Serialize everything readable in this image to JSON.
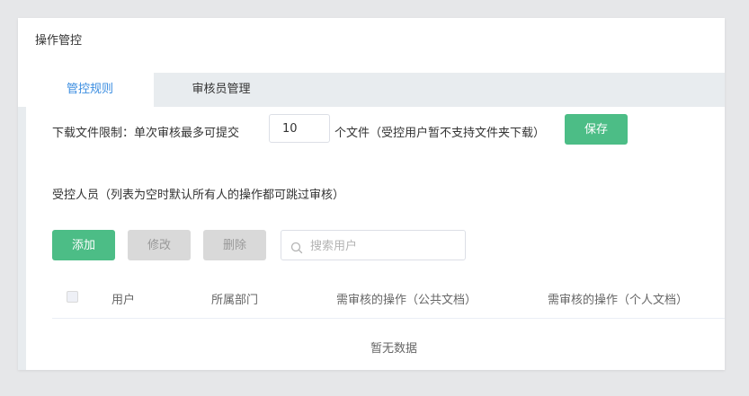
{
  "page": {
    "title": "操作管控"
  },
  "tabs": [
    {
      "label": "管控规则",
      "active": true
    },
    {
      "label": "审核员管理",
      "active": false
    }
  ],
  "download_limit": {
    "prefix": "下载文件限制：单次审核最多可提交",
    "value": "10",
    "suffix": "个文件（受控用户暂不支持文件夹下载）",
    "save_label": "保存"
  },
  "controlled_users": {
    "label": "受控人员（列表为空时默认所有人的操作都可跳过审核）",
    "add_label": "添加",
    "edit_label": "修改",
    "delete_label": "删除",
    "search_placeholder": "搜索用户"
  },
  "table": {
    "columns": [
      "用户",
      "所属部门",
      "需审核的操作（公共文档）",
      "需审核的操作（个人文档）"
    ],
    "empty_text": "暂无数据"
  },
  "colors": {
    "accent_green": "#4cbd86",
    "active_tab_text": "#3b8de0",
    "disabled_button": "#d9d9d9"
  },
  "icons": {
    "search": "search-icon"
  }
}
